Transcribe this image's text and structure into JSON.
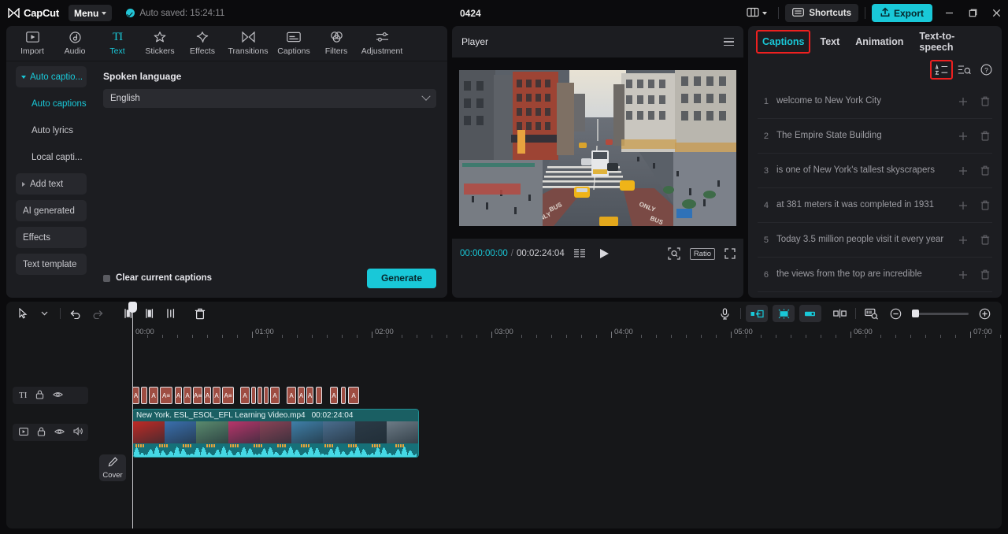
{
  "app": {
    "brand": "CapCut",
    "menu_label": "Menu",
    "autosave_text": "Auto saved: 15:24:11",
    "project_title": "0424"
  },
  "topbar": {
    "layout_icon": "layout-icon",
    "shortcuts_label": "Shortcuts",
    "export_label": "Export",
    "minimize": "minimize-icon",
    "maximize": "maximize-icon",
    "close": "close-icon"
  },
  "tool_tabs": [
    {
      "label": "Import",
      "icon": "import-icon",
      "active": false
    },
    {
      "label": "Audio",
      "icon": "audio-icon",
      "active": false
    },
    {
      "label": "Text",
      "icon": "text-icon",
      "active": true
    },
    {
      "label": "Stickers",
      "icon": "stickers-icon",
      "active": false
    },
    {
      "label": "Effects",
      "icon": "effects-icon",
      "active": false
    },
    {
      "label": "Transitions",
      "icon": "transitions-icon",
      "active": false
    },
    {
      "label": "Captions",
      "icon": "captions-icon",
      "active": false
    },
    {
      "label": "Filters",
      "icon": "filters-icon",
      "active": false
    },
    {
      "label": "Adjustment",
      "icon": "adjustment-icon",
      "active": false
    }
  ],
  "side_list": [
    {
      "label": "Auto captio...",
      "type": "group",
      "selected": true,
      "expanded": true
    },
    {
      "label": "Auto captions",
      "type": "sub",
      "selected": true
    },
    {
      "label": "Auto lyrics",
      "type": "sub",
      "selected": false
    },
    {
      "label": "Local capti...",
      "type": "sub",
      "selected": false
    },
    {
      "label": "Add text",
      "type": "group",
      "selected": false,
      "expanded": false
    },
    {
      "label": "AI generated",
      "type": "group",
      "selected": false
    },
    {
      "label": "Effects",
      "type": "group",
      "selected": false
    },
    {
      "label": "Text template",
      "type": "group",
      "selected": false
    }
  ],
  "auto_captions": {
    "field_label": "Spoken language",
    "language_value": "English",
    "clear_checkbox_label": "Clear current captions",
    "clear_checked": false,
    "generate_label": "Generate"
  },
  "player": {
    "title": "Player",
    "menu_icon": "hamburger-icon",
    "current_time": "00:00:00:00",
    "total_time": "00:02:24:04",
    "play_icon": "play-icon",
    "quality_icon": "quality-icon",
    "zoom_icon": "magnifier-icon",
    "ratio_label": "Ratio",
    "fullscreen_icon": "fullscreen-icon"
  },
  "captions_panel": {
    "tabs": [
      {
        "label": "Captions",
        "active": true,
        "highlighted": true
      },
      {
        "label": "Text",
        "active": false
      },
      {
        "label": "Animation",
        "active": false
      },
      {
        "label": "Text-to-speech",
        "active": false
      }
    ],
    "tools": [
      {
        "name": "translate-icon",
        "highlighted": true
      },
      {
        "name": "find-replace-icon",
        "highlighted": false
      },
      {
        "name": "help-icon",
        "highlighted": false
      }
    ],
    "rows": [
      {
        "index": "1",
        "text": "welcome to New York City"
      },
      {
        "index": "2",
        "text": "The Empire State Building"
      },
      {
        "index": "3",
        "text": "is one of New York's tallest skyscrapers"
      },
      {
        "index": "4",
        "text": "at 381 meters it was completed in 1931"
      },
      {
        "index": "5",
        "text": "Today 3.5 million people visit it every year"
      },
      {
        "index": "6",
        "text": "the views from the top are incredible"
      }
    ],
    "row_add_icon": "add-icon",
    "row_delete_icon": "trash-icon"
  },
  "timeline": {
    "tools_left": [
      {
        "name": "select-cursor-icon"
      },
      {
        "name": "cursor-dropdown-icon"
      },
      {
        "name": "undo-icon"
      },
      {
        "name": "redo-icon"
      },
      {
        "name": "split-left-icon"
      },
      {
        "name": "split-right-icon"
      },
      {
        "name": "split-icon"
      },
      {
        "name": "delete-icon"
      }
    ],
    "tools_right": [
      {
        "name": "microphone-icon"
      },
      {
        "name": "keyframe-prev-icon"
      },
      {
        "name": "keyframe-add-icon"
      },
      {
        "name": "keyframe-next-icon"
      },
      {
        "name": "mirror-icon"
      },
      {
        "name": "crop-icon"
      },
      {
        "name": "zoom-out-icon"
      },
      {
        "name": "zoom-in-icon"
      }
    ],
    "ruler_labels": [
      "00:00",
      "01:00",
      "02:00",
      "03:00",
      "04:00",
      "05:00",
      "06:00",
      "07:00"
    ],
    "text_track_icons": [
      "text-track-icon",
      "lock-icon",
      "eye-icon"
    ],
    "video_track_icons": [
      "video-track-icon",
      "lock-icon",
      "eye-icon",
      "speaker-icon"
    ],
    "cover_label": "Cover",
    "cover_icon": "pencil-icon",
    "clip_name": "New York. ESL_ESOL_EFL Learning Video.mp4",
    "clip_duration": "00:02:24:04"
  },
  "colors": {
    "accent": "#19c8d8",
    "highlight": "#ee2020",
    "panel": "#1c1d21",
    "clip_text": "#9e4d42",
    "clip_video": "#1a5f63"
  }
}
